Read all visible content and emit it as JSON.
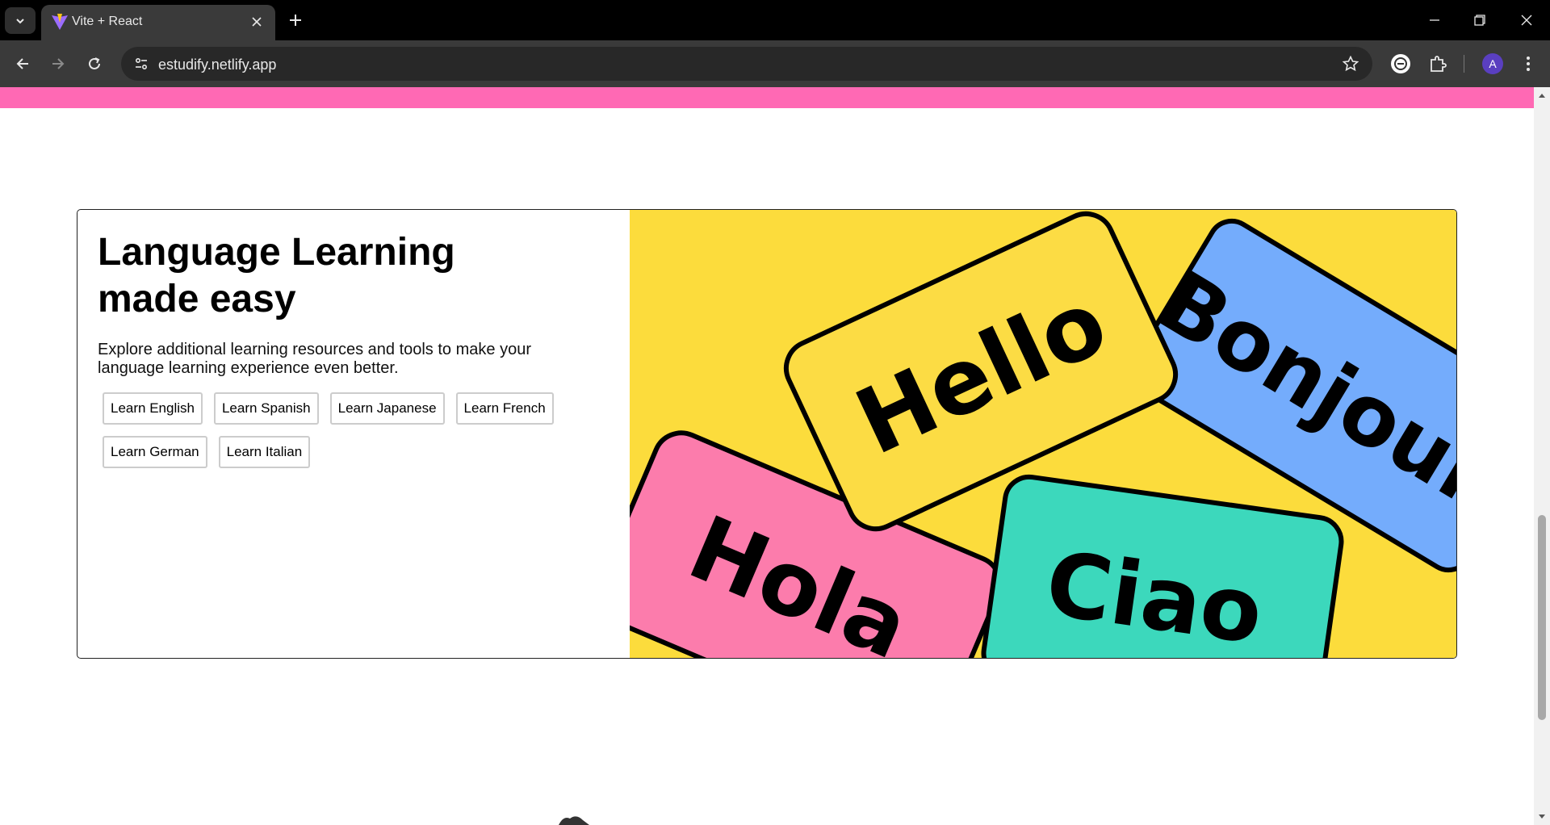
{
  "browser": {
    "tab_title": "Vite + React",
    "url": "estudify.netlify.app",
    "profile_initial": "A"
  },
  "hero": {
    "title": "Language Learning made easy",
    "description": "Explore additional learning resources and tools to make your language learning experience even better.",
    "buttons": [
      "Learn English",
      "Learn Spanish",
      "Learn Japanese",
      "Learn French",
      "Learn German",
      "Learn Italian"
    ]
  },
  "image_words": [
    "Hello",
    "Bonjour",
    "Hola",
    "Ciao"
  ],
  "colors": {
    "pink_strip": "#ff69b4",
    "image_background": "#fcdc3c",
    "card_hello": "#fcdc44",
    "card_bonjour": "#74acfc",
    "card_hola": "#fc7cac",
    "card_ciao": "#3cd8bc"
  }
}
